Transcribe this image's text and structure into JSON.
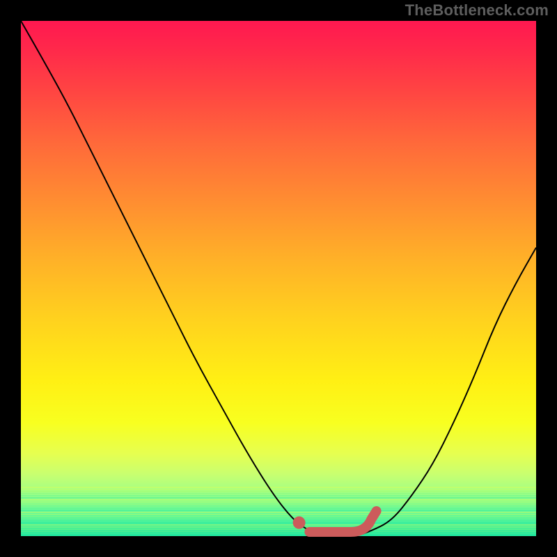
{
  "watermark": "TheBottleneck.com",
  "colors": {
    "curve": "#000000",
    "marker": "#cc5b5b",
    "gradient_top": "#ff1850",
    "gradient_bottom": "#1ee8a0"
  },
  "chart_data": {
    "type": "line",
    "title": "",
    "xlabel": "",
    "ylabel": "",
    "xlim": [
      0,
      100
    ],
    "ylim": [
      0,
      100
    ],
    "series": [
      {
        "name": "bottleneck_curve",
        "x": [
          0,
          4,
          9,
          14,
          19,
          24,
          29,
          34,
          39,
          44,
          49,
          53,
          56,
          59,
          62,
          65,
          68,
          72,
          76,
          80,
          84,
          88,
          92,
          96,
          100
        ],
        "y": [
          100,
          93,
          84,
          74,
          64,
          54,
          44,
          34,
          25,
          16,
          8,
          3,
          1,
          0,
          0,
          0,
          1,
          3,
          8,
          14,
          22,
          31,
          41,
          49,
          56
        ]
      }
    ],
    "optimal_region": {
      "x_start": 54,
      "x_end": 68,
      "y": 0
    },
    "optimal_point": {
      "x": 54,
      "y": 1.8
    }
  }
}
